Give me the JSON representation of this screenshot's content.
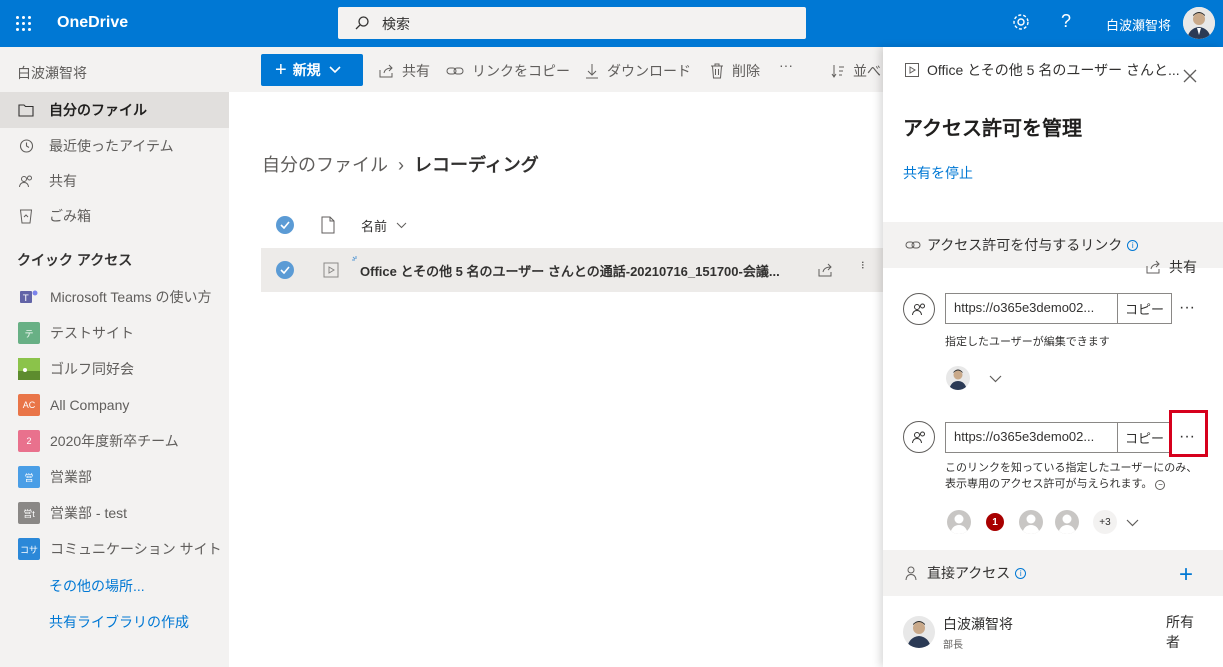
{
  "topbar": {
    "app_name": "OneDrive",
    "search_placeholder": "検索",
    "help_label": "?",
    "user_name": "白波瀬智将"
  },
  "sidebar": {
    "owner": "白波瀬智将",
    "items": [
      {
        "label": "自分のファイル",
        "icon": "folder-icon",
        "active": true
      },
      {
        "label": "最近使ったアイテム",
        "icon": "history-icon"
      },
      {
        "label": "共有",
        "icon": "people-icon"
      },
      {
        "label": "ごみ箱",
        "icon": "recycle-bin-icon"
      }
    ],
    "quick_access_label": "クイック アクセス",
    "sites": [
      {
        "label": "Microsoft Teams の使い方",
        "icon_text": "",
        "color": "#6264a7"
      },
      {
        "label": "テストサイト",
        "icon_text": "テ",
        "color": "#68b085"
      },
      {
        "label": "ゴルフ同好会",
        "icon_text": "",
        "color": "#7ab648"
      },
      {
        "label": "All Company",
        "icon_text": "AC",
        "color": "#e97548"
      },
      {
        "label": "2020年度新卒チーム",
        "icon_text": "2",
        "color": "#e9718d"
      },
      {
        "label": "営業部",
        "icon_text": "営",
        "color": "#4a9ee6"
      },
      {
        "label": "営業部 - test",
        "icon_text": "営t",
        "color": "#8a8886"
      },
      {
        "label": "コミュニケーション サイト",
        "icon_text": "コサ",
        "color": "#2b88d8"
      }
    ],
    "more_places": "その他の場所...",
    "create_library": "共有ライブラリの作成"
  },
  "commandbar": {
    "new_label": "新規",
    "share_label": "共有",
    "copy_link_label": "リンクをコピー",
    "download_label": "ダウンロード",
    "delete_label": "削除",
    "more_label": "···",
    "sort_label": "並べ"
  },
  "main": {
    "breadcrumb_root": "自分のファイル",
    "breadcrumb_current": "レコーディング",
    "column_name": "名前",
    "file_name": "Office とその他 5 名のユーザー さんとの通話-20210716_151700-会議..."
  },
  "panel": {
    "file_title": "Office とその他 5 名のユーザー さんと...",
    "title": "アクセス許可を管理",
    "stop_sharing": "共有を停止",
    "links_section": "アクセス許可を付与するリンク",
    "share_label": "共有",
    "links": [
      {
        "url": "https://o365e3demo02...",
        "copy_label": "コピー",
        "description": "指定したユーザーが編集できます"
      },
      {
        "url": "https://o365e3demo02...",
        "copy_label": "コピー",
        "description_line1": "このリンクを知っている指定したユーザーにのみ、",
        "description_line2": "表示専用のアクセス許可が与えられます。",
        "badge_count": "1",
        "extra_count": "+3"
      }
    ],
    "direct_access_section": "直接アクセス",
    "owner": {
      "name": "白波瀬智将",
      "title": "部長",
      "role": "所有者"
    }
  }
}
